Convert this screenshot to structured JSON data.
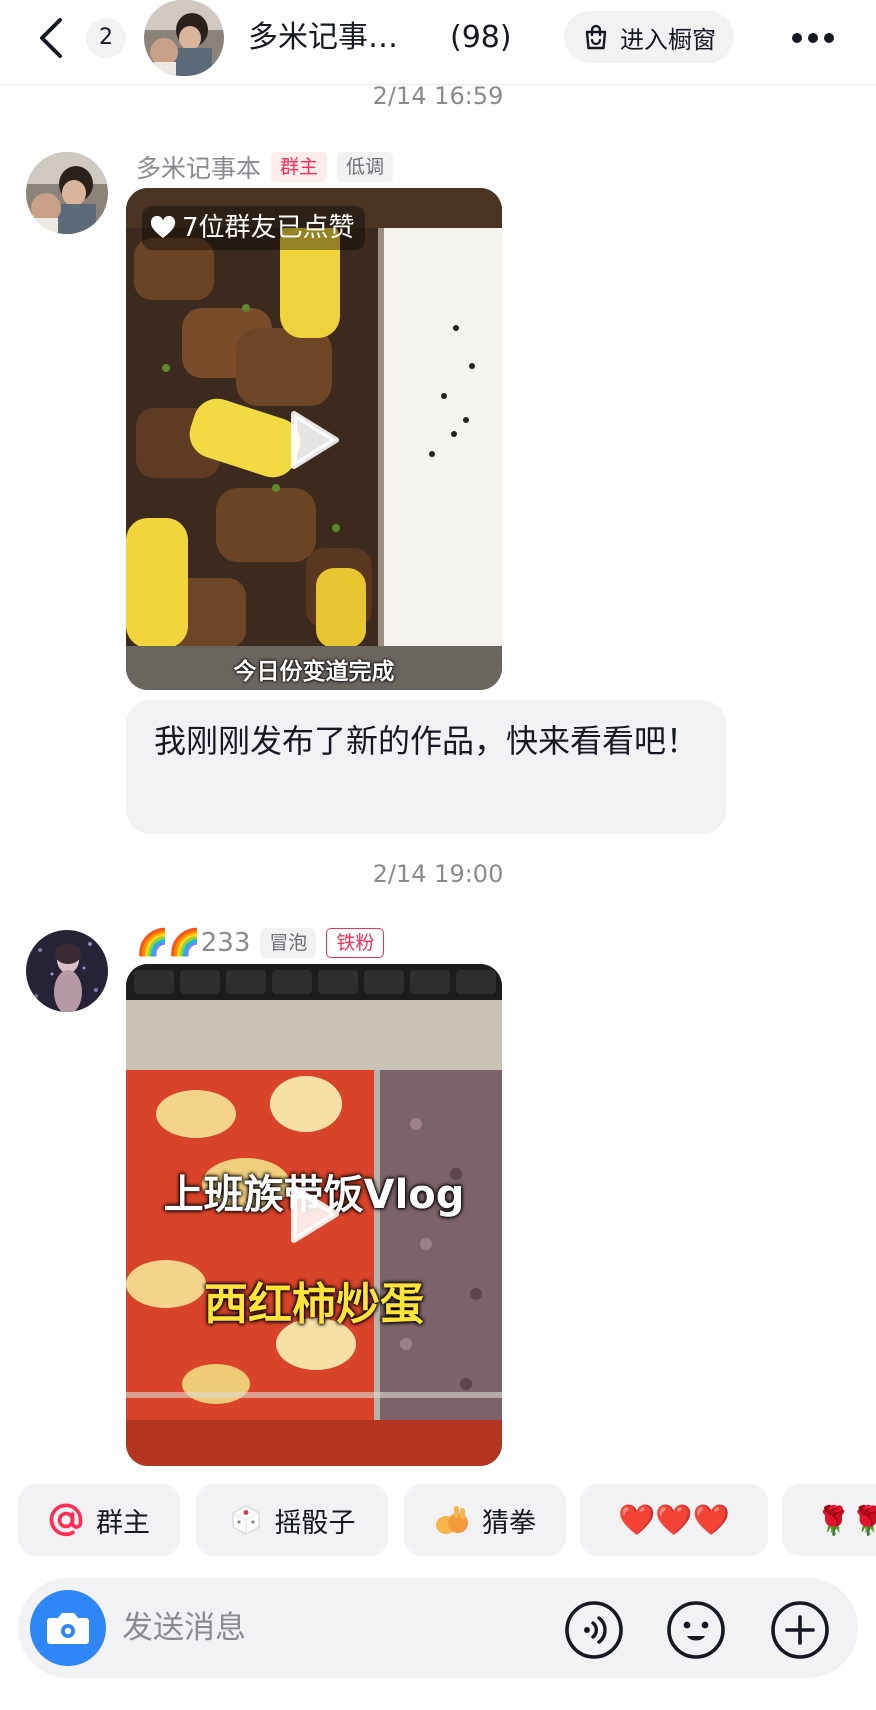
{
  "header": {
    "unread_count": "2",
    "group_title": "多米记事…",
    "member_count": "(98)",
    "showcase_label": "进入橱窗"
  },
  "messages": [
    {
      "timestamp": "2/14 16:59",
      "sender": "多米记事本",
      "tags": [
        "群主",
        "低调"
      ],
      "video": {
        "likes": "7位群友已点赞",
        "caption": "今日份变道完成"
      },
      "text": "我刚刚发布了新的作品，快来看看吧！"
    },
    {
      "timestamp": "2/14 19:00",
      "sender": "🌈🌈233",
      "tags": [
        "冒泡",
        "铁粉"
      ],
      "video": {
        "overlay_title": "上班族带饭Vlog",
        "overlay_subtitle": "西红柿炒蛋"
      }
    }
  ],
  "quick_replies": [
    "群主",
    "摇骰子",
    "猜拳",
    "❤️❤️❤️",
    "🌹🌹"
  ],
  "input": {
    "placeholder": "发送消息"
  },
  "colors": {
    "accent_red": "#fe2c55",
    "camera_blue": "#2f86f6",
    "bubble_gray": "#f2f2f4"
  },
  "icons": [
    "back-icon",
    "bag-icon",
    "more-icon",
    "heart-icon",
    "play-icon",
    "at-icon",
    "dice-icon",
    "rock-paper-scissors-icon",
    "camera-icon",
    "voice-icon",
    "emoji-icon",
    "plus-icon"
  ]
}
